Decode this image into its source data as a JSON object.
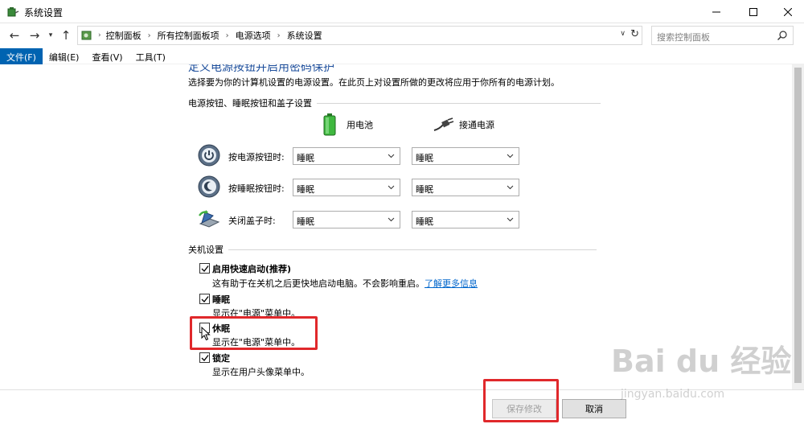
{
  "window": {
    "title": "系统设置"
  },
  "address": {
    "crumbs": [
      "控制面板",
      "所有控制面板项",
      "电源选项",
      "系统设置"
    ]
  },
  "search": {
    "placeholder": "搜索控制面板"
  },
  "menubar": {
    "items": [
      "文件(F)",
      "编辑(E)",
      "查看(V)",
      "工具(T)"
    ]
  },
  "main": {
    "heading": "定义电源按钮并启用密码保护",
    "description": "选择要为你的计算机设置的电源设置。在此页上对设置所做的更改将应用于你所有的电源计划。",
    "buttons_section": {
      "title": "电源按钮、睡眠按钮和盖子设置",
      "col_battery": "用电池",
      "col_plugged": "接通电源",
      "rows": [
        {
          "label": "按电源按钮时:",
          "battery": "睡眠",
          "plugged": "睡眠"
        },
        {
          "label": "按睡眠按钮时:",
          "battery": "睡眠",
          "plugged": "睡眠"
        },
        {
          "label": "关闭盖子时:",
          "battery": "睡眠",
          "plugged": "睡眠"
        }
      ]
    },
    "shutdown_section": {
      "title": "关机设置",
      "options": [
        {
          "label": "启用快速启动(推荐)",
          "desc": "这有助于在关机之后更快地启动电脑。不会影响重启。",
          "link": "了解更多信息",
          "checked": true
        },
        {
          "label": "睡眠",
          "desc": "显示在\"电源\"菜单中。",
          "checked": true
        },
        {
          "label": "休眠",
          "desc": "显示在\"电源\"菜单中。",
          "checked": false
        },
        {
          "label": "锁定",
          "desc": "显示在用户头像菜单中。",
          "checked": true
        }
      ]
    }
  },
  "footer": {
    "save": "保存修改",
    "cancel": "取消"
  },
  "watermark": {
    "text": "Bai du 经验",
    "sub": "jingyan.baidu.com"
  },
  "colors": {
    "accent": "#0063b1",
    "link": "#0066cc",
    "highlight": "#e0282b"
  }
}
